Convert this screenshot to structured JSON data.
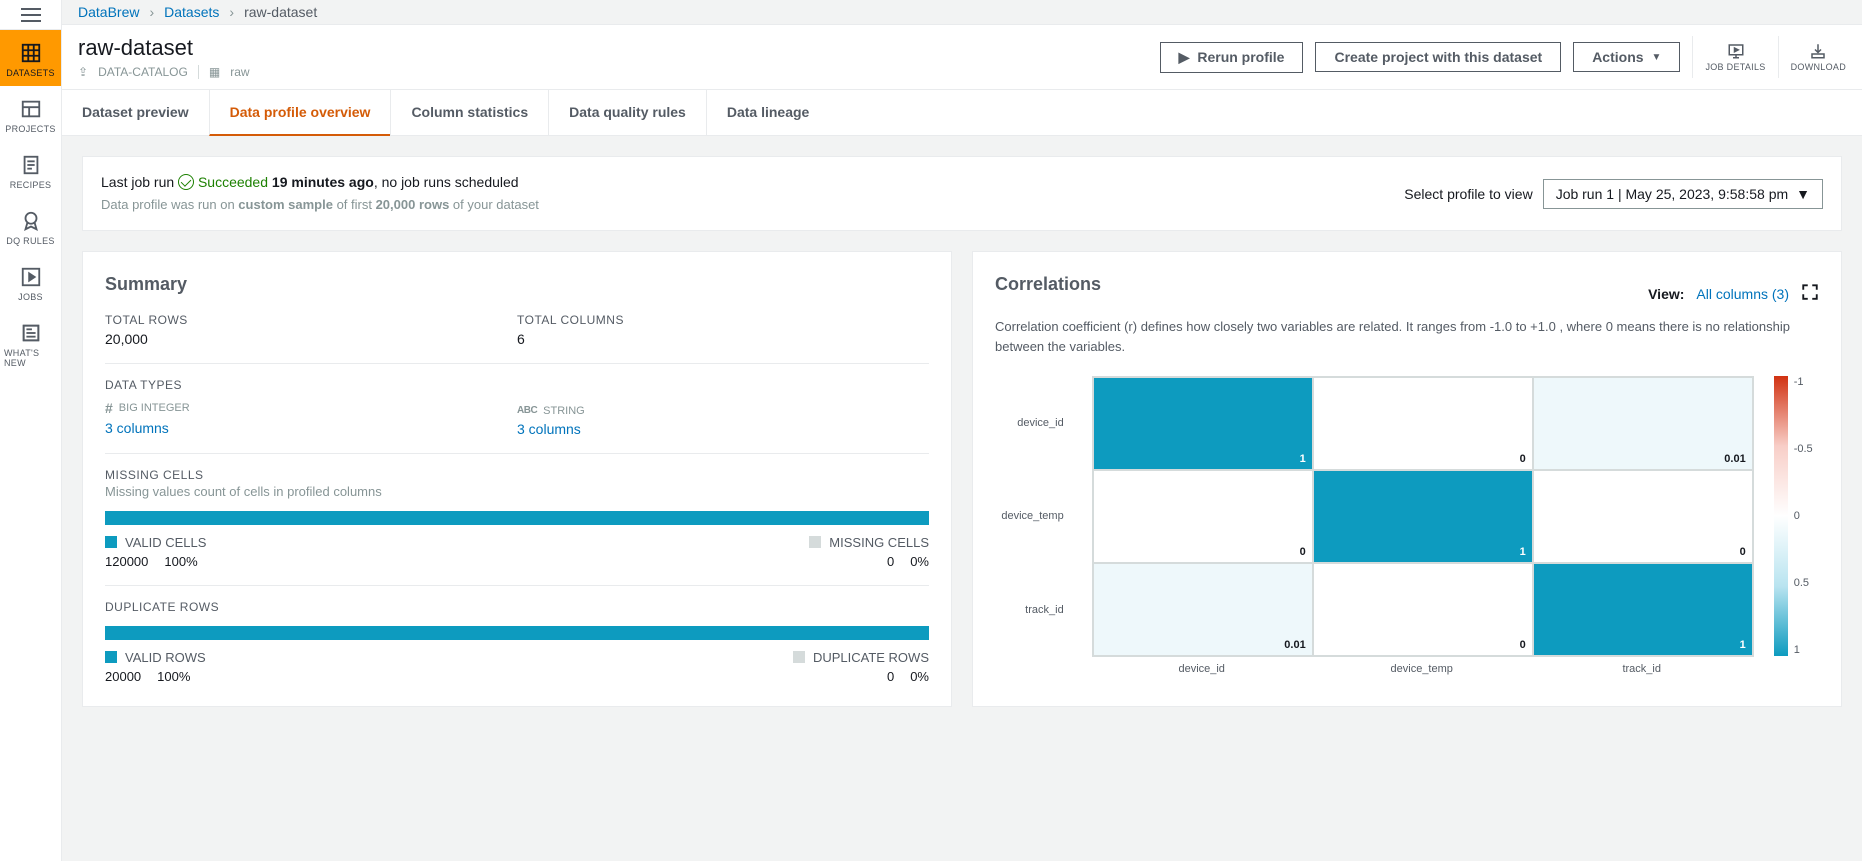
{
  "breadcrumb": {
    "root": "DataBrew",
    "section": "Datasets",
    "current": "raw-dataset"
  },
  "page_title": "raw-dataset",
  "meta": {
    "catalog": "DATA-CATALOG",
    "table": "raw"
  },
  "header_buttons": {
    "rerun": "Rerun profile",
    "create_project": "Create project with this dataset",
    "actions": "Actions",
    "job_details": "JOB DETAILS",
    "download": "DOWNLOAD"
  },
  "sidebar": {
    "items": [
      "DATASETS",
      "PROJECTS",
      "RECIPES",
      "DQ RULES",
      "JOBS",
      "WHAT'S NEW"
    ]
  },
  "tabs": [
    "Dataset preview",
    "Data profile overview",
    "Column statistics",
    "Data quality rules",
    "Data lineage"
  ],
  "active_tab": 1,
  "status": {
    "prefix": "Last job run",
    "state": "Succeeded",
    "time": "19 minutes ago",
    "suffix": ", no job runs scheduled",
    "sub_prefix": "Data profile was run on ",
    "sub_strong1": "custom sample",
    "sub_mid": " of first ",
    "sub_strong2": "20,000 rows",
    "sub_suffix": " of your dataset",
    "selector_label": "Select profile to view",
    "selector_value": "Job run 1 | May 25, 2023, 9:58:58 pm"
  },
  "summary": {
    "title": "Summary",
    "total_rows_label": "TOTAL ROWS",
    "total_rows_value": "20,000",
    "total_cols_label": "TOTAL COLUMNS",
    "total_cols_value": "6",
    "data_types_label": "DATA TYPES",
    "type1_name": "BIG INTEGER",
    "type1_link": "3 columns",
    "type2_name": "STRING",
    "type2_link": "3 columns",
    "missing_title": "MISSING CELLS",
    "missing_sub": "Missing values count of cells in profiled columns",
    "valid_cells_label": "VALID CELLS",
    "valid_cells_count": "120000",
    "valid_cells_pct": "100%",
    "missing_cells_label": "MISSING CELLS",
    "missing_cells_count": "0",
    "missing_cells_pct": "0%",
    "dup_title": "DUPLICATE ROWS",
    "valid_rows_label": "VALID ROWS",
    "valid_rows_count": "20000",
    "valid_rows_pct": "100%",
    "dup_rows_label": "DUPLICATE ROWS",
    "dup_rows_count": "0",
    "dup_rows_pct": "0%"
  },
  "correlations": {
    "title": "Correlations",
    "view_label": "View:",
    "view_link": "All columns (3)",
    "description": "Correlation coefficient (r) defines how closely two variables are related. It ranges from -1.0 to +1.0 , where 0 means there is no relationship between the variables.",
    "scale_labels": [
      "-1",
      "-0.5",
      "0",
      "0.5",
      "1"
    ]
  },
  "chart_data": {
    "type": "heatmap",
    "x_labels": [
      "device_id",
      "device_temp",
      "track_id"
    ],
    "y_labels": [
      "device_id",
      "device_temp",
      "track_id"
    ],
    "values": [
      [
        1,
        0,
        0.01
      ],
      [
        0,
        1,
        0
      ],
      [
        0.01,
        0,
        1
      ]
    ],
    "scale_min": -1,
    "scale_max": 1,
    "title": "Correlations"
  }
}
